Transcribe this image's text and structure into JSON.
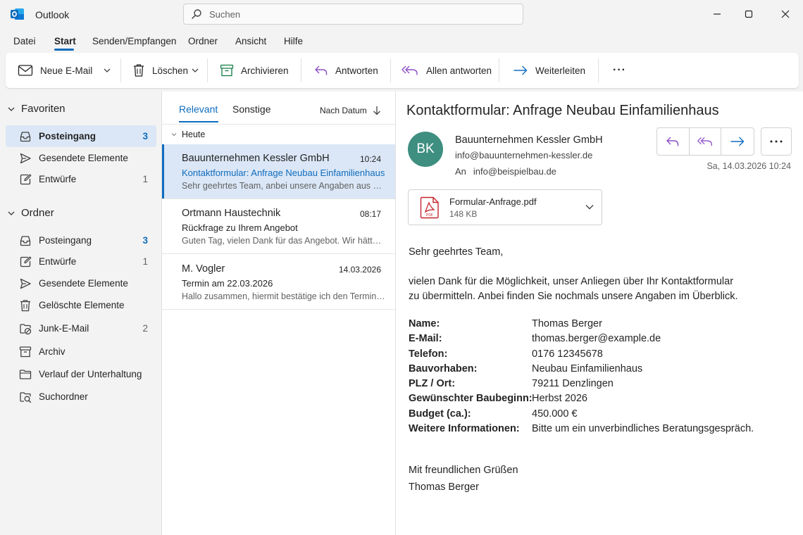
{
  "app": {
    "title": "Outlook",
    "logo_icon": "outlook-logo-icon",
    "accent": "#0f6cbd"
  },
  "search": {
    "placeholder": "Suchen",
    "icon": "search-icon"
  },
  "menu": {
    "items": [
      "Datei",
      "Start",
      "Senden/Empfangen",
      "Ordner",
      "Ansicht",
      "Hilfe"
    ],
    "active": "Start"
  },
  "ribbon": {
    "new_mail": "Neue E-Mail",
    "delete": "Löschen",
    "archive": "Archivieren",
    "reply": "Antworten",
    "reply_all": "Allen antworten",
    "forward": "Weiterleiten",
    "more": "···"
  },
  "folders": {
    "favorites": {
      "title": "Favoriten",
      "items": [
        {
          "name": "Posteingang",
          "count": "3",
          "icon": "inbox-icon",
          "selected": true
        },
        {
          "name": "Gesendete Elemente",
          "count": "",
          "icon": "send-icon"
        },
        {
          "name": "Entwürfe",
          "count": "1",
          "icon": "draft-icon"
        }
      ]
    },
    "all": {
      "title": "Ordner",
      "items": [
        {
          "name": "Posteingang",
          "count": "3",
          "icon": "inbox-icon"
        },
        {
          "name": "Entwürfe",
          "count": "1",
          "icon": "draft-icon"
        },
        {
          "name": "Gesendete Elemente",
          "count": "",
          "icon": "send-icon"
        },
        {
          "name": "Gelöschte Elemente",
          "count": "",
          "icon": "trash-icon"
        },
        {
          "name": "Junk-E-Mail",
          "count": "2",
          "icon": "junk-icon"
        },
        {
          "name": "Archiv",
          "count": "",
          "icon": "archive-icon"
        },
        {
          "name": "Verlauf der Unterhaltung",
          "count": "",
          "icon": "folder-icon"
        },
        {
          "name": "Suchordner",
          "count": "",
          "icon": "search-folder-icon"
        }
      ]
    }
  },
  "message_list": {
    "tabs": [
      "Relevant",
      "Sonstige"
    ],
    "sort_label": "Nach Datum",
    "group_label": "Heute",
    "messages": [
      {
        "sender": "Bauunternehmen Kessler GmbH",
        "time": "10:24",
        "subject": "Kontaktformular: Anfrage Neubau Einfamilienhaus",
        "preview": "Sehr geehrtes Team, anbei unsere Angaben aus dem Kontaktformular",
        "selected": true
      },
      {
        "sender": "Ortmann Haustechnik",
        "time": "08:17",
        "subject": "Rückfrage zu Ihrem Angebot",
        "preview": "Guten Tag, vielen Dank für das Angebot. Wir hätten noch eine Frage"
      },
      {
        "sender": "M. Vogler",
        "time": "14.03.2026",
        "subject": "Termin am 22.03.2026",
        "preview": "Hallo zusammen, hiermit bestätige ich den Termin am Samstag"
      }
    ]
  },
  "reading": {
    "subject": "Kontaktformular: Anfrage Neubau Einfamilienhaus",
    "avatar_initials": "BK",
    "avatar_color": "#3e8f80",
    "from_name": "Bauunternehmen Kessler GmbH",
    "from_email": "info@bauunternehmen-kessler.de",
    "to_label": "An",
    "to_email": "info@beispielbau.de",
    "date": "Sa, 14.03.2026 10:24",
    "attachment": {
      "name": "Formular-Anfrage.pdf",
      "size": "148 KB"
    },
    "greeting": "Sehr geehrtes Team,",
    "intro_line1": "vielen Dank für die Möglichkeit, unser Anliegen über Ihr Kontaktformular",
    "intro_line2": "zu übermitteln. Anbei finden Sie nochmals unsere Angaben im Überblick.",
    "fields": [
      {
        "label": "Name:",
        "value": "Thomas Berger"
      },
      {
        "label": "E-Mail:",
        "value": "thomas.berger@example.de"
      },
      {
        "label": "Telefon:",
        "value": "0176 12345678"
      },
      {
        "label": "Bauvorhaben:",
        "value": "Neubau Einfamilienhaus"
      },
      {
        "label": "PLZ / Ort:",
        "value": "79211 Denzlingen"
      },
      {
        "label": "Gewünschter Baubeginn:",
        "value": "Herbst 2026"
      },
      {
        "label": "Budget (ca.):",
        "value": "450.000 €"
      },
      {
        "label": "Weitere Informationen:",
        "value": "Bitte um ein unverbindliches Beratungsgespräch."
      }
    ],
    "closing": "Mit freundlichen Grüßen",
    "signature": "Thomas Berger"
  }
}
